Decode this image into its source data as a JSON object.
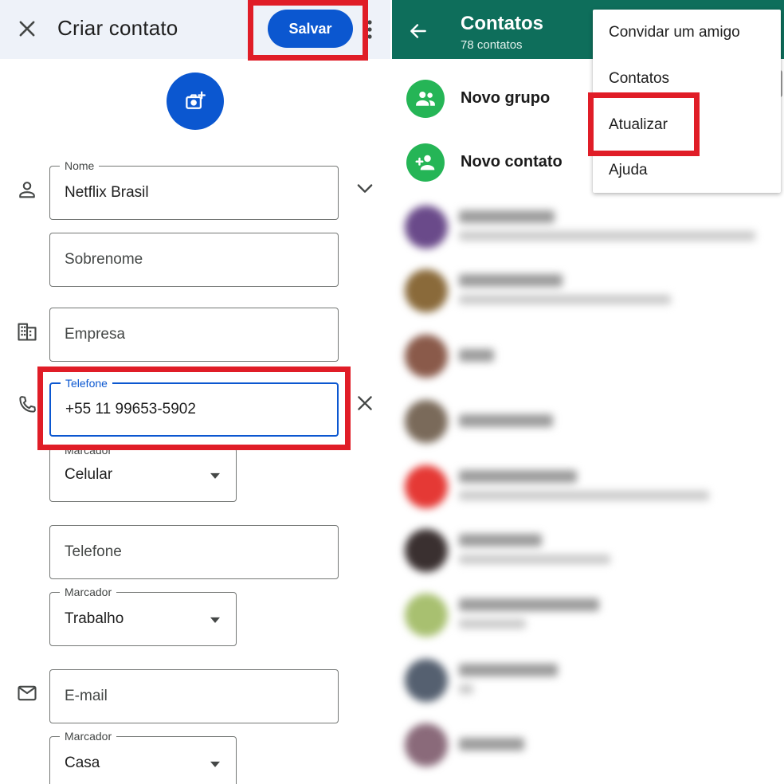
{
  "left": {
    "title": "Criar contato",
    "save_label": "Salvar",
    "fields": {
      "first_name": {
        "label": "Nome",
        "value": "Netflix Brasil"
      },
      "last_name": {
        "placeholder": "Sobrenome"
      },
      "company": {
        "placeholder": "Empresa"
      },
      "phone1": {
        "label": "Telefone",
        "value": "+55 11 99653-5902"
      },
      "phone1_label": {
        "label": "Marcador",
        "value": "Celular"
      },
      "phone2": {
        "placeholder": "Telefone"
      },
      "phone2_label": {
        "label": "Marcador",
        "value": "Trabalho"
      },
      "email": {
        "placeholder": "E-mail"
      },
      "email_label": {
        "label": "Marcador",
        "value": "Casa"
      }
    }
  },
  "right": {
    "title": "Contatos",
    "subtitle": "78 contatos",
    "actions": [
      "Novo grupo",
      "Novo contato"
    ],
    "menu": [
      "Convidar um amigo",
      "Contatos",
      "Atualizar",
      "Ajuda"
    ],
    "blurred_contacts": [
      {
        "avatar_color": "#6a4a8a"
      },
      {
        "avatar_color": "#8a6a3a"
      },
      {
        "avatar_color": "#8a5a4a"
      },
      {
        "avatar_color": "#7a6a5a"
      },
      {
        "avatar_color": "#e53935"
      },
      {
        "avatar_color": "#3a3030"
      },
      {
        "avatar_color": "#a8c070"
      },
      {
        "avatar_color": "#556070"
      },
      {
        "avatar_color": "#8a6a7a"
      }
    ]
  },
  "colors": {
    "accent_blue": "#0b57d0",
    "whatsapp_green": "#0e6e5b",
    "action_green": "#25b556",
    "highlight_red": "#e01d27"
  }
}
